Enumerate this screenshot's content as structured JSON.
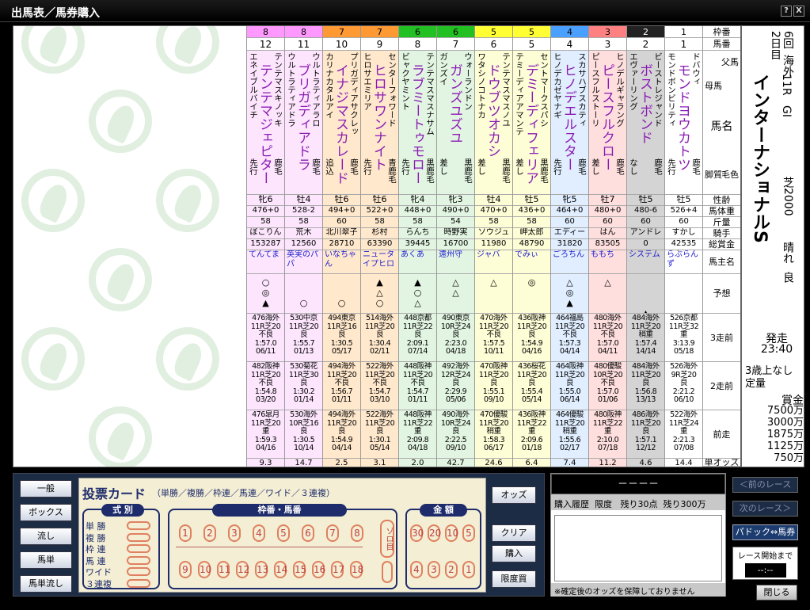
{
  "window": {
    "title": "出馬表／馬券購入",
    "help": "?",
    "close": "X"
  },
  "labels": [
    "枠番",
    "馬番",
    "父馬",
    "母馬",
    "馬名",
    "脚質",
    "毛色",
    "性齢",
    "馬体重",
    "斤量",
    "騎手",
    "総賞金",
    "馬主名",
    "予想",
    "3走前",
    "2走前",
    "前走",
    "単オッズ"
  ],
  "colors": {
    "w1": "#ffffff",
    "w2": "#222222",
    "w3": "#ff8080",
    "w4": "#4aa0ff",
    "w5": "#ffff33",
    "w6": "#22c022",
    "w7": "#ff9933",
    "w8": "#ff99ff"
  },
  "horses": [
    {
      "waku": "8",
      "wc": "#ff99ff",
      "bg": "#fde6fd",
      "num": "12",
      "sire": "テンテマスキノッキ",
      "dam": "エネイブルバイチ",
      "name": "テンテマジェピター",
      "style": "先行",
      "coat": "鹿毛",
      "sa": "牝6",
      "wt": "476+0",
      "kin": "58",
      "jockey": "ぼこりん",
      "prize": "153287",
      "owner": "てんてま",
      "mk": "○\n◎\n▲",
      "r3": "476海外\n11R芝20\n不良\n1:57.0\n06/11",
      "r2": "482阪神\n11R芝20\n不良\n1:54.8\n03/20",
      "r1": "476皐月\n11R芝20\n重\n1:59.3\n04/16",
      "odds": "9.3"
    },
    {
      "waku": "8",
      "wc": "#ff99ff",
      "bg": "#fde6fd",
      "num": "11",
      "sire": "ウルトラティアラロ",
      "dam": "ウルトラティアドラ",
      "name": "ブリガディアドラ",
      "style": "",
      "coat": "鹿毛",
      "sa": "牡4",
      "wt": "528-2",
      "kin": "58",
      "jockey": "荒木",
      "prize": "12560",
      "owner": "英実のパパ",
      "mk": "\n\n○",
      "r3": "530中京\n11R芝20\n良\n1:55.7\n01/13",
      "r2": "530菊花\n11R芝30\n良\n1:30.2\n01/14",
      "r1": "530海外\n10R芝16\n良\n1:30.5\n10/14",
      "odds": "14.7"
    },
    {
      "waku": "7",
      "wc": "#ff9933",
      "bg": "#ffe8cc",
      "num": "10",
      "sire": "プリガディアサクレッ",
      "dam": "カリナカタルアイ",
      "name": "イナジマスカレード",
      "style": "追込",
      "coat": "鹿毛",
      "sa": "牡6",
      "wt": "494+0",
      "kin": "60",
      "jockey": "北川翠子",
      "prize": "28710",
      "owner": "いなちゃん",
      "mk": "\n\n○",
      "r3": "494東京\n11R芝16\n良\n1:30.5\n05/17",
      "r2": "494海外\n11R芝20\n不良\n1:56.7\n01/11",
      "r1": "494海外\n11R芝20\n良\n1:54.9\n04/14",
      "odds": "2.5"
    },
    {
      "waku": "7",
      "wc": "#ff9933",
      "bg": "#ffe8cc",
      "num": "9",
      "sire": "センターフォワード",
      "dam": "ヒロサエミリア",
      "name": "ヒロサワンナイト",
      "style": "先行",
      "coat": "青鹿毛",
      "sa": "牡6",
      "wt": "522+0",
      "kin": "58",
      "jockey": "杉村",
      "prize": "63390",
      "owner": "ニュータイプヒロ",
      "mk": "▲\n△\n○",
      "r3": "514海外\n11R芝20\n良\n1:30.4\n02/11",
      "r2": "522海外\n11R芝20\n不良\n1:54.7\n03/10",
      "r1": "522海外\n11R芝20\n良\n1:30.1\n05/14",
      "odds": "3.1"
    },
    {
      "waku": "6",
      "wc": "#22c022",
      "bg": "#e2f5e2",
      "num": "8",
      "sire": "テンテマスマスナサム",
      "dam": "ビャクヤミント",
      "name": "ラブミートゥモロー",
      "style": "先行",
      "coat": "黒鹿毛",
      "sa": "牝4",
      "wt": "448+0",
      "kin": "58",
      "jockey": "らんち",
      "prize": "39445",
      "owner": "あくあ",
      "mk": "▲\n○\n△",
      "r3": "448京都\n11R芝22\n良\n2:09.1\n07/14",
      "r2": "448阪神\n11R芝20\n不良\n1:54.7\n01/11",
      "r1": "448阪神\n11R芝22\n重\n2:09.8\n04/18",
      "odds": "2.0"
    },
    {
      "waku": "6",
      "wc": "#22c022",
      "bg": "#e2f5e2",
      "num": "7",
      "sire": "ウォーランドン",
      "dam": "ガンズイ",
      "name": "ガンズユズユ",
      "style": "差し",
      "coat": "黒鹿毛",
      "sa": "牝3",
      "wt": "490+0",
      "kin": "54",
      "jockey": "時野実",
      "prize": "16700",
      "owner": "遠州守",
      "mk": "△\n△",
      "r3": "490東京\n10R芝24\n良\n2:23.0\n04/18",
      "r2": "492海外\n12R芝24\n良\n2:29.9\n05/06",
      "r1": "490海外\n10R芝24\n良\n2:22.5\n09/10",
      "odds": "42.7"
    },
    {
      "waku": "5",
      "wc": "#ffff33",
      "bg": "#fdfdd6",
      "num": "6",
      "sire": "テンテマスマスノユ",
      "dam": "ワタシノコトナカ",
      "name": "ドウブツオカシ",
      "style": "差し",
      "coat": "黒鹿毛",
      "sa": "牡4",
      "wt": "470+0",
      "kin": "58",
      "jockey": "ソウジュ",
      "prize": "11980",
      "owner": "ジャバ",
      "mk": "△",
      "r3": "470海外\n11R芝20\n不良\n1:57.5\n10/11",
      "r2": "470阪神\n11R芝20\n良\n1:55.1\n09/10",
      "r1": "470優駿\n11R芝20\n稍重\n1:58.3\n06/17",
      "odds": "24.6"
    },
    {
      "waku": "5",
      "wc": "#ffff33",
      "bg": "#fdfdd6",
      "num": "5",
      "sire": "セントマークスパシ",
      "dam": "テミーディアアマンテ",
      "name": "デミーディフェリア",
      "style": "差し",
      "coat": "黒鹿毛",
      "sa": "牡5",
      "wt": "436+0",
      "kin": "58",
      "jockey": "岬太郎",
      "prize": "48790",
      "owner": "でみぃ",
      "mk": "◎",
      "r3": "436阪神\n11R芝20\n良\n1:54.9\n04/16",
      "r2": "436桜花\n11R芝20\n良\n1:55.4\n05/14",
      "r1": "436阪神\n11R芝22\n重\n2:09.6\n01/18",
      "odds": "6.4"
    },
    {
      "waku": "4",
      "wc": "#4aa0ff",
      "bg": "#e0eeff",
      "num": "4",
      "sire": "スカサハブスカティ",
      "dam": "ヒノデカゼヤナギ",
      "name": "ヒノデエルスター",
      "style": "先行",
      "coat": "鹿毛",
      "sa": "牝5",
      "wt": "464+0",
      "kin": "60",
      "jockey": "エディー",
      "prize": "31820",
      "owner": "ごろちん",
      "mk": "△\n◎\n▲",
      "r3": "464福島\n11R芝20\n不良\n1:57.3\n04/14",
      "r2": "464阪神\n11R芝20\n良\n1:55.0\n06/14",
      "r1": "464優駿\n11R芝20\n稍重\n1:55.6\n02/17",
      "odds": "7.4"
    },
    {
      "waku": "3",
      "wc": "#ff8080",
      "bg": "#ffdede",
      "num": "3",
      "sire": "ヒノデルギャラング",
      "dam": "ピースフルストーリ",
      "name": "ピースフルクロー",
      "style": "差し",
      "coat": "鹿毛",
      "sa": "牡7",
      "wt": "480+0",
      "kin": "60",
      "jockey": "はん",
      "prize": "83505",
      "owner": "ももち",
      "mk": "△",
      "r3": "480海外\n11R芝20\n不良\n1:57.0\n04/11",
      "r2": "480優駿\n10R芝20\n不良\n1:57.0\n01/06",
      "r1": "480阪神\n11R芝22\n重\n2:10.0\n07/18",
      "odds": "11.2"
    },
    {
      "waku": "2",
      "wc": "#222222",
      "bg": "#d4d4d4",
      "num": "2",
      "sire": "ビーストレジャンド",
      "dam": "エヴァーリング",
      "name": "ボストボンド",
      "style": "なし",
      "coat": "鹿毛",
      "sa": "牡5",
      "wt": "480-6",
      "kin": "60",
      "jockey": "アンドレ",
      "prize": "0",
      "owner": "システム",
      "mk": "\n\n\n▲",
      "r3": "484海外\n11R芝20\n稍重\n1:57.4\n14/14",
      "r2": "484海外\n11R芝20\n良\n1:56.8\n13/13",
      "r1": "486海外\n11R芝20\n良\n1:57.1\n12/12",
      "odds": "4.6"
    },
    {
      "waku": "1",
      "wc": "#ffffff",
      "bg": "#ffffff",
      "num": "1",
      "sire": "ドバウィ",
      "dam": "モンドボンビリティ",
      "name": "モンドヨウカトツ",
      "style": "先行",
      "coat": "鹿毛",
      "sa": "牡5",
      "wt": "526+4",
      "kin": "60",
      "jockey": "すかし",
      "prize": "42535",
      "owner": "らぶらんず",
      "mk": "",
      "r3": "526京都\n11R芝32\n重\n3:13.9\n05/18",
      "r2": "526海外\n9R芝20\n良\n2:21.2\n06/10",
      "r1": "522海外\n11R芝24\n重\n2:21.3\n07/08",
      "odds": "14.4"
    }
  ],
  "race": {
    "kai": "6回",
    "place": "海外",
    "day": "2日目",
    "rnum": "11R",
    "grade": "GI",
    "name": "インターナショナルS",
    "surface": "芝2000",
    "weather": "晴れ",
    "cond": "良",
    "start": "発走",
    "time": "23:40",
    "cls": "3歳上なし",
    "rule": "定量",
    "prize_label": "賞金",
    "prizes": [
      "7500万",
      "3000万",
      "1875万",
      "1125万",
      "750万"
    ]
  },
  "left_buttons": [
    "一般",
    "ボックス",
    "流し",
    "馬単",
    "馬単流し"
  ],
  "ticket": {
    "title": "投票カード",
    "sub": "（単勝／複勝／枠連／馬連／ワイド／３連複）",
    "shiki": "式 別",
    "types": [
      "単 勝",
      "複 勝",
      "枠 連",
      "馬 連",
      "ワイド",
      "３連複"
    ],
    "wakuban": "枠番・馬番",
    "nums_top": [
      "1",
      "2",
      "3",
      "4",
      "5",
      "6",
      "7",
      "8"
    ],
    "nums_bot": [
      "9",
      "10",
      "11",
      "12",
      "13",
      "14",
      "15",
      "16",
      "17",
      "18"
    ],
    "zoro": "ゾロ目",
    "amount": "金 額",
    "amts_top": [
      "30",
      "20",
      "10",
      "5"
    ],
    "amts_bot": [
      "4",
      "3",
      "2",
      "1"
    ]
  },
  "right_buttons": [
    "オッズ",
    "クリア",
    "購入",
    "限度買"
  ],
  "history": {
    "head": "－－－－",
    "label": "購入履歴",
    "limit": "限度",
    "rem1": "残り30点",
    "rem2": "残り300万",
    "note": "※確定後のオッズを保障しておりません"
  },
  "nav": {
    "prev": "＜前のレース",
    "next": "次のレース＞",
    "paddock": "パドック⇔馬券",
    "until": "レース開始まで",
    "timer": "--:--",
    "close": "閉じる"
  }
}
